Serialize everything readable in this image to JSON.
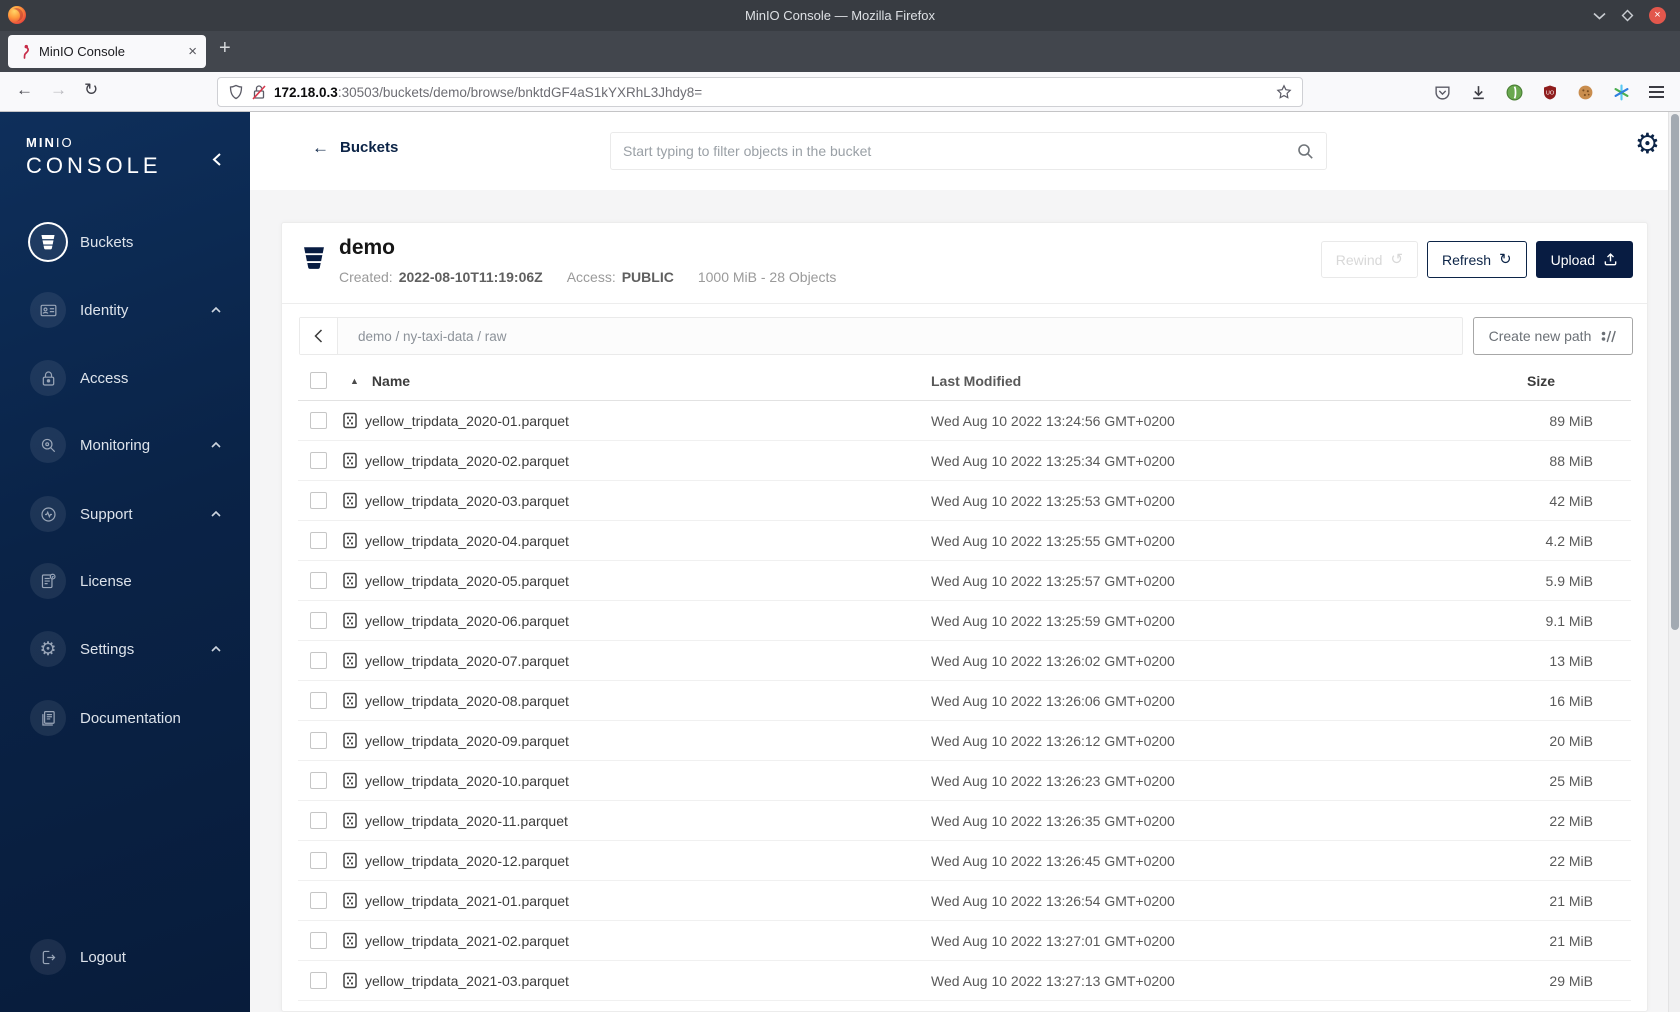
{
  "browser": {
    "window_title": "MinIO Console — Mozilla Firefox",
    "tab_title": "MinIO Console",
    "new_tab_label": "+",
    "url_host": "172.18.0.3",
    "url_rest": ":30503/buckets/demo/browse/bnktdGF4aS1kYXRhL3Jhdy8="
  },
  "glyphs": {
    "back": "←",
    "forward": "→",
    "reload": "↻",
    "close_tab": "×",
    "close_window": "×",
    "sort_asc": "▲",
    "rewind": "↺",
    "refresh": "↻",
    "gear": "⚙",
    "page_back": "←"
  },
  "colors": {
    "brand_navy": "#081C42",
    "sidebar_top": "#0E2F5B",
    "sidebar_bottom": "#081C3B",
    "close_red": "#E2574C",
    "muted_text": "#8C9299"
  },
  "sidebar": {
    "logo_min": "MIN",
    "logo_io": "IO",
    "logo_console": "CONSOLE",
    "items": [
      {
        "label": "Buckets",
        "active": true,
        "expandable": false
      },
      {
        "label": "Identity",
        "active": false,
        "expandable": true
      },
      {
        "label": "Access",
        "active": false,
        "expandable": false
      },
      {
        "label": "Monitoring",
        "active": false,
        "expandable": true
      },
      {
        "label": "Support",
        "active": false,
        "expandable": true
      },
      {
        "label": "License",
        "active": false,
        "expandable": false
      },
      {
        "label": "Settings",
        "active": false,
        "expandable": true
      },
      {
        "label": "Documentation",
        "active": false,
        "expandable": false
      }
    ],
    "logout_label": "Logout"
  },
  "header": {
    "back_label": "Buckets",
    "search_placeholder": "Start typing to filter objects in the bucket"
  },
  "bucket": {
    "name": "demo",
    "created_label": "Created:",
    "created_value": "2022-08-10T11:19:06Z",
    "access_label": "Access:",
    "access_value": "PUBLIC",
    "usage": "1000 MiB - 28 Objects"
  },
  "actions": {
    "rewind": "Rewind",
    "refresh": "Refresh",
    "upload": "Upload",
    "create_path": "Create new path"
  },
  "breadcrumb": {
    "path": "demo / ny-taxi-data / raw"
  },
  "table": {
    "columns": [
      "Name",
      "Last Modified",
      "Size"
    ],
    "rows": [
      {
        "name": "yellow_tripdata_2020-01.parquet",
        "modified": "Wed Aug 10 2022 13:24:56 GMT+0200",
        "size": "89 MiB"
      },
      {
        "name": "yellow_tripdata_2020-02.parquet",
        "modified": "Wed Aug 10 2022 13:25:34 GMT+0200",
        "size": "88 MiB"
      },
      {
        "name": "yellow_tripdata_2020-03.parquet",
        "modified": "Wed Aug 10 2022 13:25:53 GMT+0200",
        "size": "42 MiB"
      },
      {
        "name": "yellow_tripdata_2020-04.parquet",
        "modified": "Wed Aug 10 2022 13:25:55 GMT+0200",
        "size": "4.2 MiB"
      },
      {
        "name": "yellow_tripdata_2020-05.parquet",
        "modified": "Wed Aug 10 2022 13:25:57 GMT+0200",
        "size": "5.9 MiB"
      },
      {
        "name": "yellow_tripdata_2020-06.parquet",
        "modified": "Wed Aug 10 2022 13:25:59 GMT+0200",
        "size": "9.1 MiB"
      },
      {
        "name": "yellow_tripdata_2020-07.parquet",
        "modified": "Wed Aug 10 2022 13:26:02 GMT+0200",
        "size": "13 MiB"
      },
      {
        "name": "yellow_tripdata_2020-08.parquet",
        "modified": "Wed Aug 10 2022 13:26:06 GMT+0200",
        "size": "16 MiB"
      },
      {
        "name": "yellow_tripdata_2020-09.parquet",
        "modified": "Wed Aug 10 2022 13:26:12 GMT+0200",
        "size": "20 MiB"
      },
      {
        "name": "yellow_tripdata_2020-10.parquet",
        "modified": "Wed Aug 10 2022 13:26:23 GMT+0200",
        "size": "25 MiB"
      },
      {
        "name": "yellow_tripdata_2020-11.parquet",
        "modified": "Wed Aug 10 2022 13:26:35 GMT+0200",
        "size": "22 MiB"
      },
      {
        "name": "yellow_tripdata_2020-12.parquet",
        "modified": "Wed Aug 10 2022 13:26:45 GMT+0200",
        "size": "22 MiB"
      },
      {
        "name": "yellow_tripdata_2021-01.parquet",
        "modified": "Wed Aug 10 2022 13:26:54 GMT+0200",
        "size": "21 MiB"
      },
      {
        "name": "yellow_tripdata_2021-02.parquet",
        "modified": "Wed Aug 10 2022 13:27:01 GMT+0200",
        "size": "21 MiB"
      },
      {
        "name": "yellow_tripdata_2021-03.parquet",
        "modified": "Wed Aug 10 2022 13:27:13 GMT+0200",
        "size": "29 MiB"
      }
    ]
  }
}
